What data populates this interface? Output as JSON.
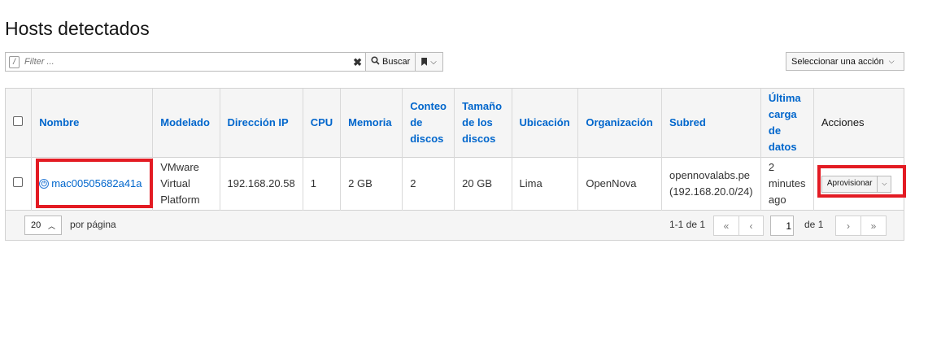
{
  "page": {
    "title": "Hosts detectados"
  },
  "toolbar": {
    "filter_placeholder": "Filter ...",
    "search_label": "Buscar",
    "action_select_label": "Seleccionar una acción"
  },
  "table": {
    "headers": {
      "nombre": "Nombre",
      "modelado": "Modelado",
      "ip": "Dirección IP",
      "cpu": "CPU",
      "memoria": "Memoria",
      "conteo": "Conteo de discos",
      "tamano": "Tamaño de los discos",
      "ubicacion": "Ubicación",
      "organizacion": "Organización",
      "subred": "Subred",
      "ultima": "Última carga de datos",
      "acciones": "Acciones"
    },
    "rows": [
      {
        "nombre": "mac00505682a41a",
        "modelado": "VMware Virtual Platform",
        "ip": "192.168.20.58",
        "cpu": "1",
        "memoria": "2 GB",
        "conteo": "2",
        "tamano": "20 GB",
        "ubicacion": "Lima",
        "organizacion": "OpenNova",
        "subred": "opennovalabs.pe (192.168.20.0/24)",
        "ultima": "2 minutes ago",
        "accion": "Aprovisionar"
      }
    ]
  },
  "pagination": {
    "per_page": "20",
    "per_page_label": "por página",
    "range_label": "1-1 de",
    "range_total": "1",
    "current_page": "1",
    "of_label": "de",
    "total_pages": "1"
  },
  "icons": {
    "power": "power-icon",
    "bookmark": "bookmark-icon",
    "clear": "clear-icon",
    "search": "search-icon"
  },
  "colors": {
    "link": "#0066cc",
    "highlight": "#e31b23"
  }
}
